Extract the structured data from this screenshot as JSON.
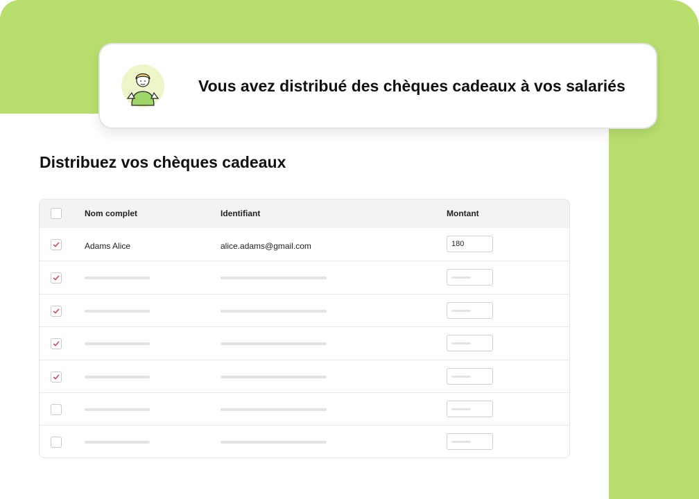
{
  "notification": {
    "message": "Vous avez distribué des chèques cadeaux à vos salariés",
    "avatar_icon": "person-holding-gift-icon"
  },
  "page_title": "Distribuez vos chèques cadeaux",
  "table": {
    "columns": [
      "Nom complet",
      "Identifiant",
      "Montant"
    ],
    "header_checkbox_checked": false,
    "rows": [
      {
        "checked": true,
        "name": "Adams Alice",
        "identifier": "alice.adams@gmail.com",
        "amount": "180"
      },
      {
        "checked": true,
        "name": null,
        "identifier": null,
        "amount": null
      },
      {
        "checked": true,
        "name": null,
        "identifier": null,
        "amount": null
      },
      {
        "checked": true,
        "name": null,
        "identifier": null,
        "amount": null
      },
      {
        "checked": true,
        "name": null,
        "identifier": null,
        "amount": null
      },
      {
        "checked": false,
        "name": null,
        "identifier": null,
        "amount": null
      },
      {
        "checked": false,
        "name": null,
        "identifier": null,
        "amount": null
      }
    ]
  },
  "colors": {
    "accent_green": "#b8df6e",
    "check_red": "#d9363e"
  }
}
